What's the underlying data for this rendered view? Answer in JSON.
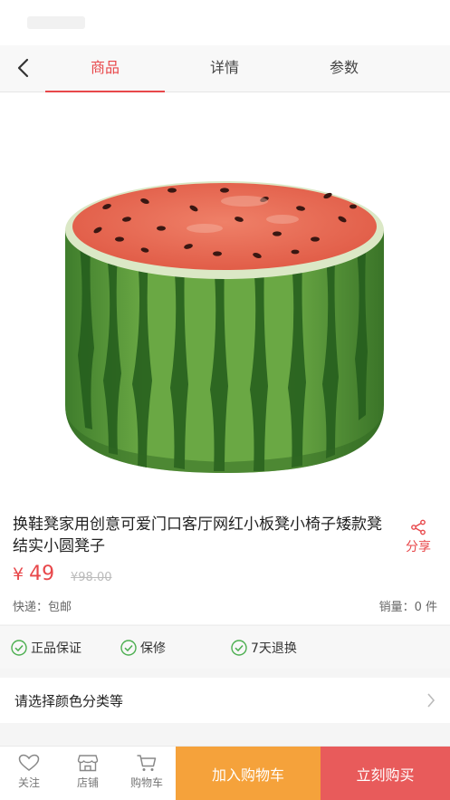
{
  "nav": {
    "tabs": [
      {
        "label": "商品",
        "active": true
      },
      {
        "label": "详情",
        "active": false
      },
      {
        "label": "参数",
        "active": false
      }
    ]
  },
  "product": {
    "title": "换鞋凳家用创意可爱门口客厅网红小板凳小椅子矮款凳结实小圆凳子",
    "currency": "¥",
    "price": "49",
    "original_price": "¥98.00",
    "shipping": "快递：包邮",
    "sales": "销量：0 件",
    "share_label": "分享",
    "image_count": 1,
    "current_image": 1
  },
  "guarantees": [
    {
      "label": "正品保证"
    },
    {
      "label": "保修"
    },
    {
      "label": "7天退换"
    }
  ],
  "spec": {
    "label": "请选择颜色分类等"
  },
  "footer": {
    "follow_label": "关注",
    "shop_label": "店铺",
    "cart_label": "购物车",
    "add_to_cart_label": "加入购物车",
    "buy_now_label": "立刻购买"
  },
  "colors": {
    "accent": "#e8474a",
    "cart_button": "#f5a23b",
    "buy_button": "#e85b5b"
  }
}
